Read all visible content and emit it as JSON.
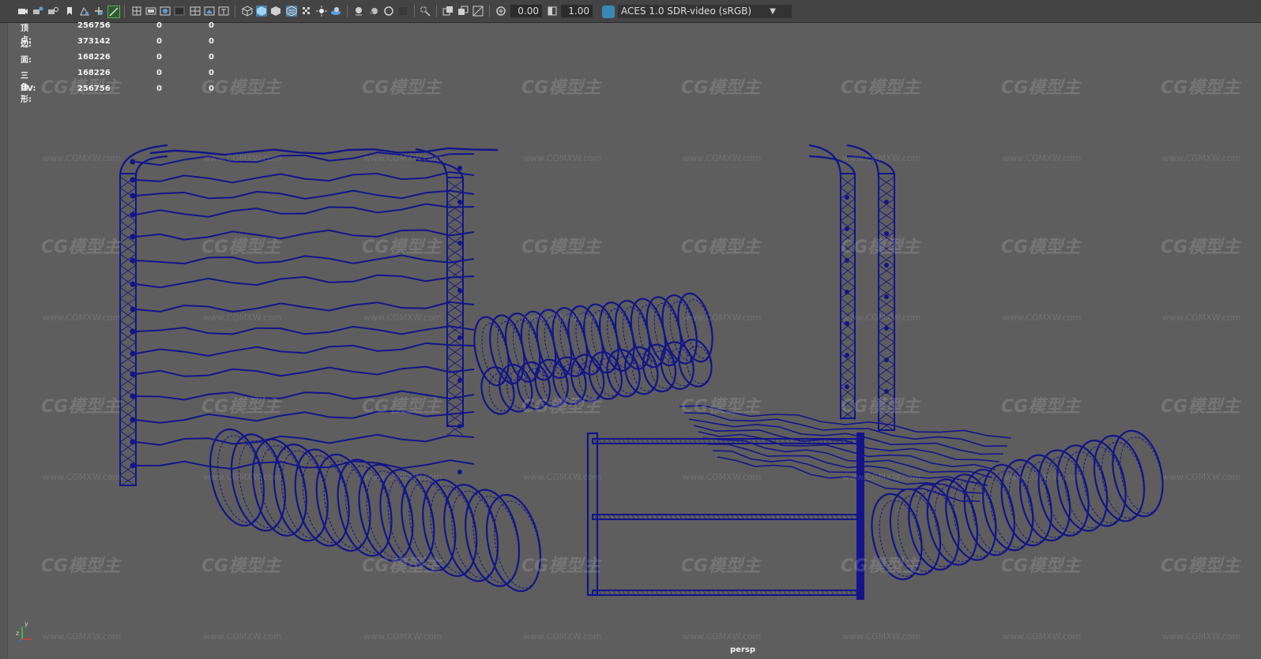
{
  "toolbar": {
    "camera_value": "0.00",
    "gamma_value": "1.00",
    "color_space": "ACES 1.0 SDR-video (sRGB)",
    "icons": [
      "camera-icon",
      "camera-attrs-icon",
      "bookmark-icon",
      "image-plane-icon",
      "grid-icon",
      "film-gate-icon",
      "resolution-gate-icon",
      "gate-mask-icon",
      "field-chart-icon",
      "safe-action-icon",
      "safe-title-icon",
      "wireframe-icon",
      "smooth-shade-icon",
      "wireframe-on-shaded-icon",
      "textured-icon",
      "lights-icon",
      "shadows-icon",
      "ambient-occlusion-icon",
      "motion-blur-icon",
      "anti-aliasing-icon",
      "depth-of-field-icon",
      "isolate-select-icon",
      "xray-icon",
      "xray-joints-icon",
      "backface-icon",
      "exposure-icon",
      "gamma-icon",
      "color-management-icon"
    ]
  },
  "hud": {
    "rows": [
      {
        "label": "顶点:",
        "v1": "256756",
        "v2": "0",
        "v3": "0"
      },
      {
        "label": "边:",
        "v1": "373142",
        "v2": "0",
        "v3": "0"
      },
      {
        "label": "面:",
        "v1": "168226",
        "v2": "0",
        "v3": "0"
      },
      {
        "label": "三角形:",
        "v1": "168226",
        "v2": "0",
        "v3": "0"
      },
      {
        "label": "UV:",
        "v1": "256756",
        "v2": "0",
        "v3": "0"
      }
    ]
  },
  "viewport": {
    "camera_label": "persp",
    "background": "#5e5e5e",
    "wire_color": "#14148a"
  },
  "watermark": {
    "brand": "CG模型主",
    "url": "www.CGMXW.com"
  },
  "axis": {
    "y": "y",
    "z": "z",
    "x": "x"
  }
}
